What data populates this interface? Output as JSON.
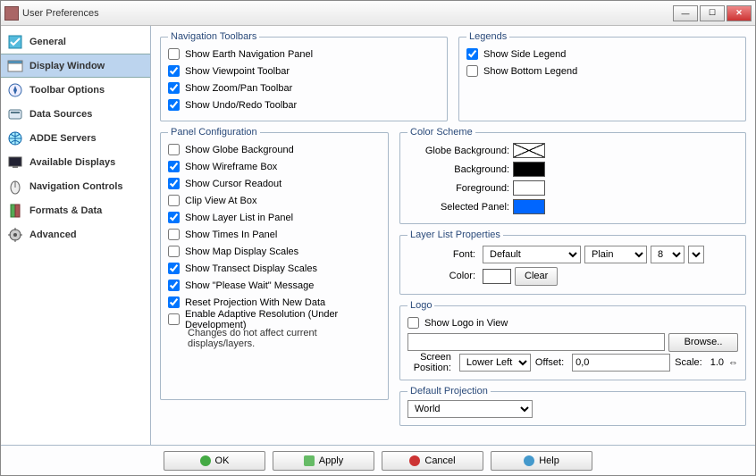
{
  "title": "User Preferences",
  "sidebar": {
    "items": [
      {
        "label": "General"
      },
      {
        "label": "Display Window"
      },
      {
        "label": "Toolbar Options"
      },
      {
        "label": "Data Sources"
      },
      {
        "label": "ADDE Servers"
      },
      {
        "label": "Available Displays"
      },
      {
        "label": "Navigation Controls"
      },
      {
        "label": "Formats & Data"
      },
      {
        "label": "Advanced"
      }
    ]
  },
  "groups": {
    "navToolbars": {
      "legend": "Navigation Toolbars",
      "items": [
        {
          "label": "Show Earth Navigation Panel",
          "checked": false
        },
        {
          "label": "Show Viewpoint Toolbar",
          "checked": true
        },
        {
          "label": "Show Zoom/Pan Toolbar",
          "checked": true
        },
        {
          "label": "Show Undo/Redo Toolbar",
          "checked": true
        }
      ]
    },
    "legends": {
      "legend": "Legends",
      "items": [
        {
          "label": "Show Side Legend",
          "checked": true
        },
        {
          "label": "Show Bottom Legend",
          "checked": false
        }
      ]
    },
    "panelConfig": {
      "legend": "Panel Configuration",
      "items": [
        {
          "label": "Show Globe Background",
          "checked": false
        },
        {
          "label": "Show Wireframe Box",
          "checked": true
        },
        {
          "label": "Show Cursor Readout",
          "checked": true
        },
        {
          "label": "Clip View At Box",
          "checked": false
        },
        {
          "label": "Show Layer List in Panel",
          "checked": true
        },
        {
          "label": "Show Times In Panel",
          "checked": false
        },
        {
          "label": "Show Map Display Scales",
          "checked": false
        },
        {
          "label": "Show Transect Display Scales",
          "checked": true
        },
        {
          "label": "Show \"Please Wait\" Message",
          "checked": true
        },
        {
          "label": "Reset Projection With New Data",
          "checked": true
        },
        {
          "label": "Enable Adaptive Resolution (Under Development)",
          "checked": false
        }
      ],
      "subnote": "Changes do not affect current displays/layers."
    },
    "colorScheme": {
      "legend": "Color Scheme",
      "rows": [
        {
          "label": "Globe Background:"
        },
        {
          "label": "Background:"
        },
        {
          "label": "Foreground:"
        },
        {
          "label": "Selected Panel:"
        }
      ]
    },
    "layerList": {
      "legend": "Layer List Properties",
      "fontLabel": "Font:",
      "fontFamily": "Default",
      "fontStyle": "Plain",
      "fontSize": "8",
      "colorLabel": "Color:",
      "clear": "Clear"
    },
    "logo": {
      "legend": "Logo",
      "showLabel": "Show Logo in View",
      "showChecked": false,
      "path": "",
      "browse": "Browse..",
      "posLabel": "Screen Position:",
      "posValue": "Lower Left",
      "offsetLabel": "Offset:",
      "offsetValue": "0,0",
      "scaleLabel": "Scale:",
      "scaleValue": "1.0"
    },
    "defProj": {
      "legend": "Default Projection",
      "value": "World"
    }
  },
  "buttons": {
    "ok": "OK",
    "apply": "Apply",
    "cancel": "Cancel",
    "help": "Help"
  }
}
